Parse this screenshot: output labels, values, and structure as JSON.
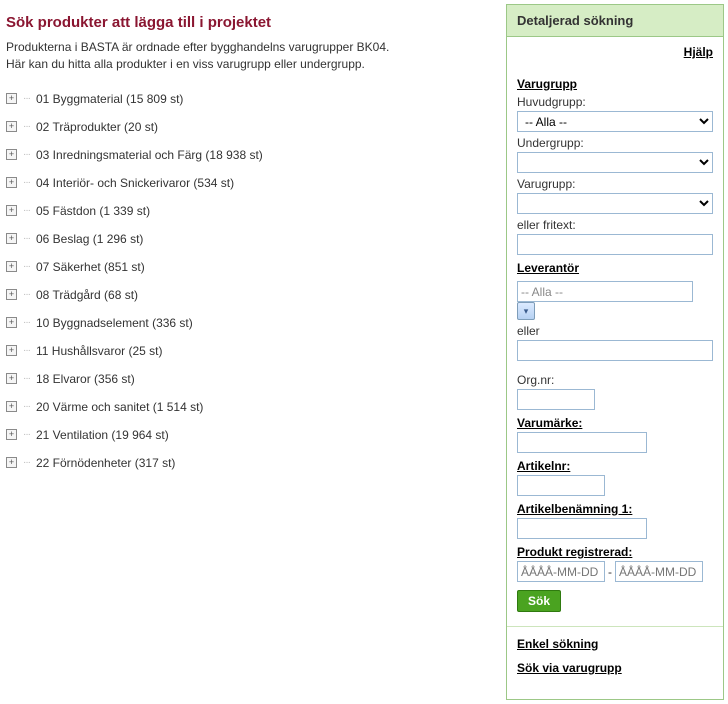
{
  "left": {
    "title": "Sök produkter att lägga till i projektet",
    "intro1": "Produkterna i BASTA är ordnade efter bygghandelns varugrupper BK04.",
    "intro2": "Här kan du hitta alla produkter i en viss varugrupp eller undergrupp.",
    "tree": [
      "01 Byggmaterial (15 809 st)",
      "02 Träprodukter (20 st)",
      "03 Inredningsmaterial och Färg (18 938 st)",
      "04 Interiör- och Snickerivaror (534 st)",
      "05 Fästdon (1 339 st)",
      "06 Beslag (1 296 st)",
      "07 Säkerhet (851 st)",
      "08 Trädgård (68 st)",
      "10 Byggnadselement (336 st)",
      "11 Hushållsvaror (25 st)",
      "18 Elvaror (356 st)",
      "20 Värme och sanitet (1 514 st)",
      "21 Ventilation (19 964 st)",
      "22 Förnödenheter (317 st)"
    ]
  },
  "right": {
    "header": "Detaljerad sökning",
    "help": "Hjälp",
    "varugrupp_section": "Varugrupp",
    "huvudgrupp_label": "Huvudgrupp:",
    "huvudgrupp_value": "-- Alla --",
    "undergrupp_label": "Undergrupp:",
    "varugrupp_label": "Varugrupp:",
    "fritext_label": "eller fritext:",
    "leverantor_section": "Leverantör",
    "leverantor_value": "-- Alla --",
    "eller_label": "eller",
    "orgnr_label": "Org.nr:",
    "varumarke_section": "Varumärke:",
    "artikelnr_section": "Artikelnr:",
    "artikelbenamning_section": "Artikelbenämning 1:",
    "produktreg_section": "Produkt registrerad:",
    "date_placeholder": "ÅÅÅÅ-MM-DD",
    "sok_button": "Sök",
    "enkel_link": "Enkel sökning",
    "viavg_link": "Sök via varugrupp"
  }
}
